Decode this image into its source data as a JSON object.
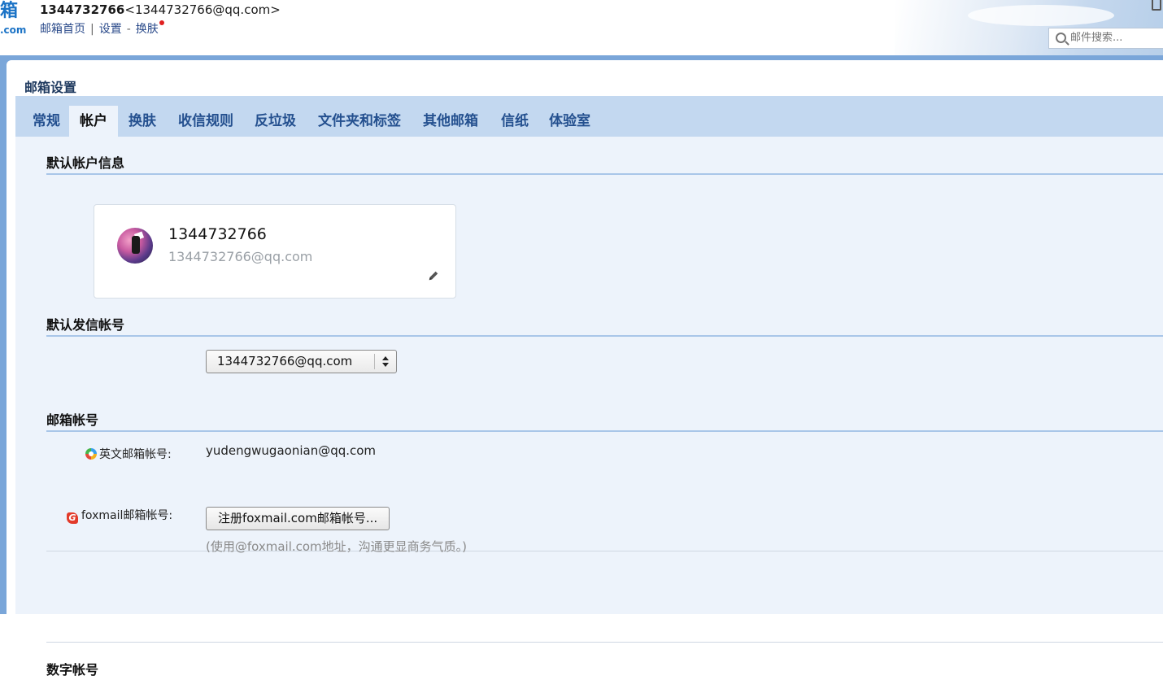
{
  "header": {
    "logo_top": "箱",
    "logo_bottom": ".com",
    "user_id": "1344732766",
    "user_email": "1344732766@qq.com",
    "nav": {
      "home": "邮箱首页",
      "sep": "|",
      "settings": "设置",
      "dash": "-",
      "skin": "换肤"
    },
    "search_placeholder": "邮件搜索..."
  },
  "page": {
    "title": "邮箱设置"
  },
  "tabs": [
    {
      "label": "常规",
      "active": false
    },
    {
      "label": "帐户",
      "active": true
    },
    {
      "label": "换肤",
      "active": false
    },
    {
      "label": "收信规则",
      "active": false
    },
    {
      "label": "反垃圾",
      "active": false
    },
    {
      "label": "文件夹和标签",
      "active": false
    },
    {
      "label": "其他邮箱",
      "active": false
    },
    {
      "label": "信纸",
      "active": false
    },
    {
      "label": "体验室",
      "active": false
    }
  ],
  "default_account": {
    "section_title": "默认帐户信息",
    "name": "1344732766",
    "email": "1344732766@qq.com"
  },
  "default_sender": {
    "section_title": "默认发信帐号",
    "selected": "1344732766@qq.com"
  },
  "mail_accounts": {
    "section_title": "邮箱帐号",
    "english_label": "英文邮箱帐号:",
    "english_value": "yudengwugaonian@qq.com",
    "foxmail_label": "foxmail邮箱帐号:",
    "foxmail_button": "注册foxmail.com邮箱帐号...",
    "foxmail_hint": "(使用@foxmail.com地址，沟通更显商务气质。)"
  },
  "digital_account": {
    "section_title": "数字帐号"
  },
  "colors": {
    "frame": "#7aa6d9",
    "tabs_bg": "#c3d8f0",
    "content_bg": "#edf3fb",
    "link": "#2a4a8a"
  }
}
